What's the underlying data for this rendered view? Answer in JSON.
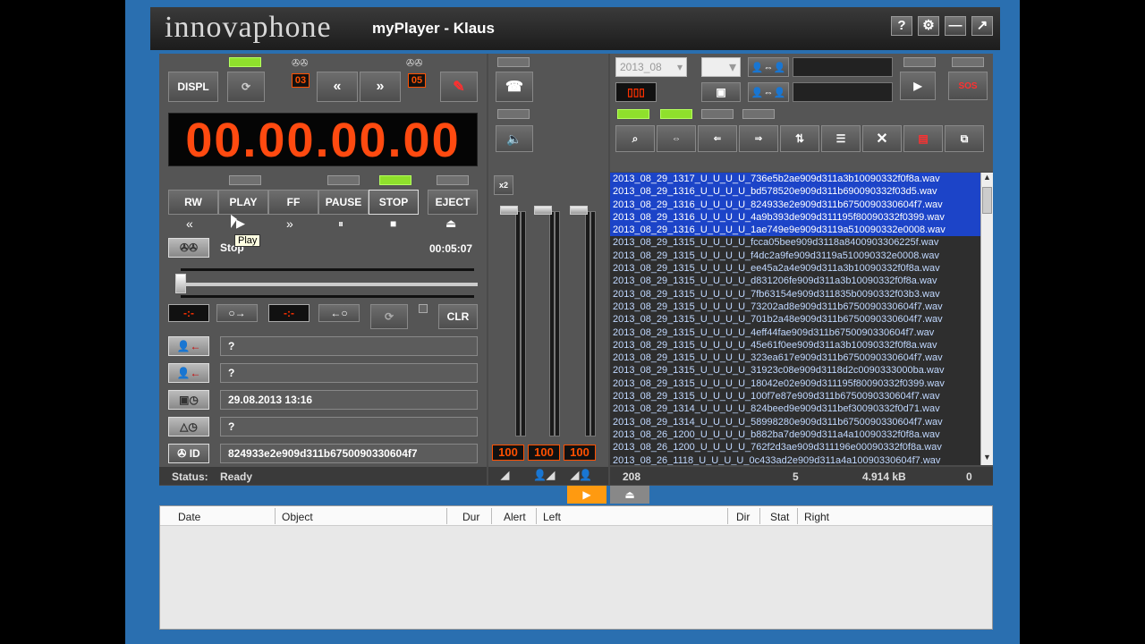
{
  "app": {
    "logo": "innovaphone",
    "title": "myPlayer - Klaus"
  },
  "titlebar_buttons": [
    "?",
    "⚙",
    "—",
    "↗"
  ],
  "player": {
    "displ_label": "DISPL",
    "counter_a": "03",
    "counter_b": "05",
    "rewind_symbol": "«",
    "forward_symbol": "»",
    "time_display": "00.00.00.00",
    "transport": {
      "rw": "RW",
      "play": "PLAY",
      "ff": "FF",
      "pause": "PAUSE",
      "stop": "STOP",
      "eject": "EJECT"
    },
    "transport_icons": [
      "«",
      "▶",
      "»",
      "⏸",
      "■",
      "⏏"
    ],
    "state": "Stop",
    "duration": "00:05:07",
    "clr_label": "CLR",
    "tooltip": "Play",
    "fields": {
      "caller": "?",
      "callee": "?",
      "datetime": "29.08.2013  13:16",
      "alert": "?",
      "id_label": "ID",
      "id_value": "824933e2e909d311b6750090330604f7"
    },
    "status_label": "Status:",
    "status_value": "Ready"
  },
  "mixer": {
    "volumes": [
      "100",
      "100",
      "100"
    ],
    "x2_label": "x2"
  },
  "browser": {
    "date_select": "2013_08",
    "files": [
      {
        "name": "2013_08_29_1317_U_U_U_U_736e5b2ae909d311a3b10090332f0f8a.wav",
        "selected": true
      },
      {
        "name": "2013_08_29_1316_U_U_U_U_bd578520e909d311b690090332f03d5.wav",
        "selected": true
      },
      {
        "name": "2013_08_29_1316_U_U_U_U_824933e2e909d311b6750090330604f7.wav",
        "selected": true
      },
      {
        "name": "2013_08_29_1316_U_U_U_U_4a9b393de909d311195f80090332f0399.wav",
        "selected": true
      },
      {
        "name": "2013_08_29_1316_U_U_U_U_1ae749e9e909d3119a510090332e0008.wav",
        "selected": true
      },
      {
        "name": "2013_08_29_1315_U_U_U_U_fcca05bee909d3118a8400903306225f.wav",
        "selected": false
      },
      {
        "name": "2013_08_29_1315_U_U_U_U_f4dc2a9fe909d3119a510090332e0008.wav",
        "selected": false
      },
      {
        "name": "2013_08_29_1315_U_U_U_U_ee45a2a4e909d311a3b10090332f0f8a.wav",
        "selected": false
      },
      {
        "name": "2013_08_29_1315_U_U_U_U_d831206fe909d311a3b10090332f0f8a.wav",
        "selected": false
      },
      {
        "name": "2013_08_29_1315_U_U_U_U_7fb63154e909d311835b0090332f03b3.wav",
        "selected": false
      },
      {
        "name": "2013_08_29_1315_U_U_U_U_73202ad8e909d311b6750090330604f7.wav",
        "selected": false
      },
      {
        "name": "2013_08_29_1315_U_U_U_U_701b2a48e909d311b6750090330604f7.wav",
        "selected": false
      },
      {
        "name": "2013_08_29_1315_U_U_U_U_4eff44fae909d311b6750090330604f7.wav",
        "selected": false
      },
      {
        "name": "2013_08_29_1315_U_U_U_U_45e61f0ee909d311a3b10090332f0f8a.wav",
        "selected": false
      },
      {
        "name": "2013_08_29_1315_U_U_U_U_323ea617e909d311b6750090330604f7.wav",
        "selected": false
      },
      {
        "name": "2013_08_29_1315_U_U_U_U_31923c08e909d3118d2c0090333000ba.wav",
        "selected": false
      },
      {
        "name": "2013_08_29_1315_U_U_U_U_18042e02e909d311195f80090332f0399.wav",
        "selected": false
      },
      {
        "name": "2013_08_29_1315_U_U_U_U_100f7e87e909d311b6750090330604f7.wav",
        "selected": false
      },
      {
        "name": "2013_08_29_1314_U_U_U_U_824beed9e909d311bef30090332f0d71.wav",
        "selected": false
      },
      {
        "name": "2013_08_29_1314_U_U_U_U_58998280e909d311b6750090330604f7.wav",
        "selected": false
      },
      {
        "name": "2013_08_26_1200_U_U_U_U_b882ba7de909d311a4a10090332f0f8a.wav",
        "selected": false
      },
      {
        "name": "2013_08_26_1200_U_U_U_U_762f2d3ae909d311196e00090332f0f8a.wav",
        "selected": false
      },
      {
        "name": "2013_08_26_1118_U_U_U_U_0c433ad2e909d311a4a10090330604f7.wav",
        "selected": false
      }
    ],
    "status": {
      "count": "208",
      "selected": "5",
      "size": "4.914 kB",
      "extra": "0"
    }
  },
  "call_table": {
    "columns": [
      "Date",
      "Object",
      "Dur",
      "Alert",
      "Left",
      "Dir",
      "Stat",
      "Right"
    ]
  }
}
